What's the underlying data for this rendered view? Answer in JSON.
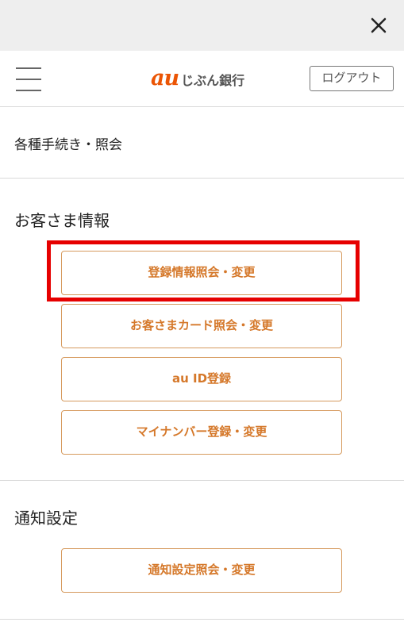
{
  "top_bar": {
    "close_icon": "close-icon"
  },
  "header": {
    "menu_icon": "hamburger-menu-icon",
    "logo": {
      "au": "au",
      "bank_name": "じぶん銀行",
      "brand_color": "#eb5505"
    },
    "logout_label": "ログアウト"
  },
  "procedures": {
    "label": "各種手続き・照会"
  },
  "customer_info": {
    "title": "お客さま情報",
    "buttons": [
      {
        "label": "登録情報照会・変更"
      },
      {
        "label": "お客さまカード照会・変更"
      },
      {
        "label": "au ID登録"
      },
      {
        "label": "マイナンバー登録・変更"
      }
    ]
  },
  "notification_settings": {
    "title": "通知設定",
    "buttons": [
      {
        "label": "通知設定照会・変更"
      }
    ]
  },
  "colors": {
    "accent": "#d5782a",
    "button_border": "#d69a5e",
    "highlight": "#e60000"
  }
}
